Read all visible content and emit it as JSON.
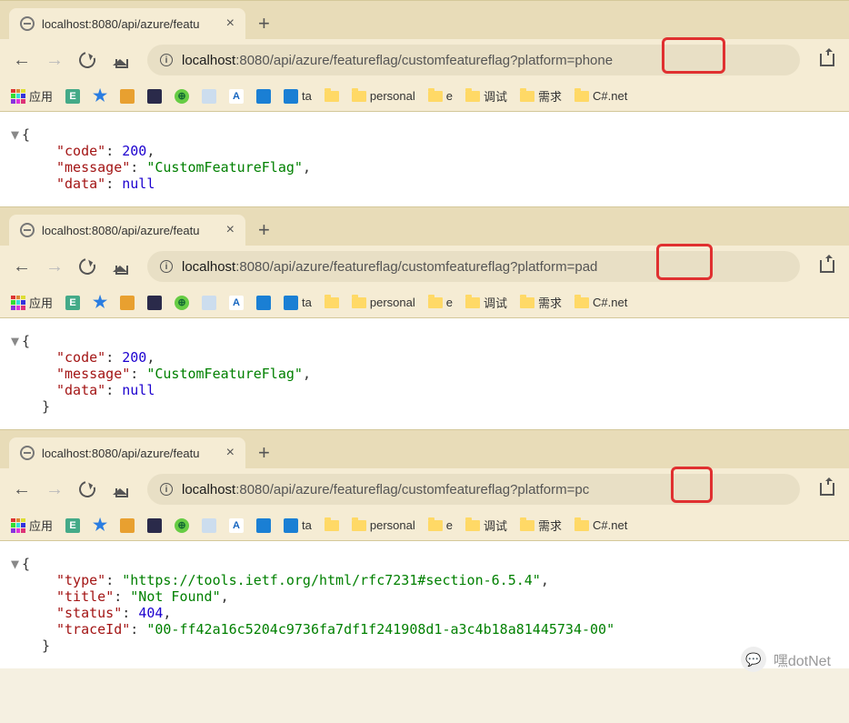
{
  "windows": [
    {
      "tab_title": "localhost:8080/api/azure/featu",
      "url_host": "localhost",
      "url_path": ":8080/api/azure/featureflag/customfeatureflag?platform=phone",
      "highlight_text": "=phone",
      "response": {
        "code": 200,
        "message": "CustomFeatureFlag",
        "data": "null"
      }
    },
    {
      "tab_title": "localhost:8080/api/azure/featu",
      "url_host": "localhost",
      "url_path": ":8080/api/azure/featureflag/customfeatureflag?platform=pad",
      "highlight_text": "=pad",
      "response": {
        "code": 200,
        "message": "CustomFeatureFlag",
        "data": "null"
      }
    },
    {
      "tab_title": "localhost:8080/api/azure/featu",
      "url_host": "localhost",
      "url_path": ":8080/api/azure/featureflag/customfeatureflag?platform=pc",
      "highlight_text": "=pc",
      "response_error": {
        "type": "https://tools.ietf.org/html/rfc7231#section-6.5.4",
        "title": "Not Found",
        "status": 404,
        "traceId": "00-ff42a16c5204c9736fa7df1f241908d1-a3c4b18a81445734-00"
      }
    }
  ],
  "bookmarks": {
    "apps": "应用",
    "items": [
      {
        "label": "E",
        "cls": "e"
      },
      {
        "label": "★",
        "cls": "star"
      },
      {
        "label": "",
        "cls": "y"
      },
      {
        "label": "",
        "cls": "cube"
      },
      {
        "label": "⊕",
        "cls": "circle"
      },
      {
        "label": "",
        "cls": "doc"
      },
      {
        "label": "A",
        "cls": "a"
      },
      {
        "label": "",
        "cls": "cl"
      },
      {
        "label": "",
        "cls": "cl2",
        "after": "ta"
      }
    ],
    "folders": [
      "personal",
      "e",
      "调试",
      "需求",
      "C#.net"
    ]
  },
  "watermark": "嘿dotNet"
}
